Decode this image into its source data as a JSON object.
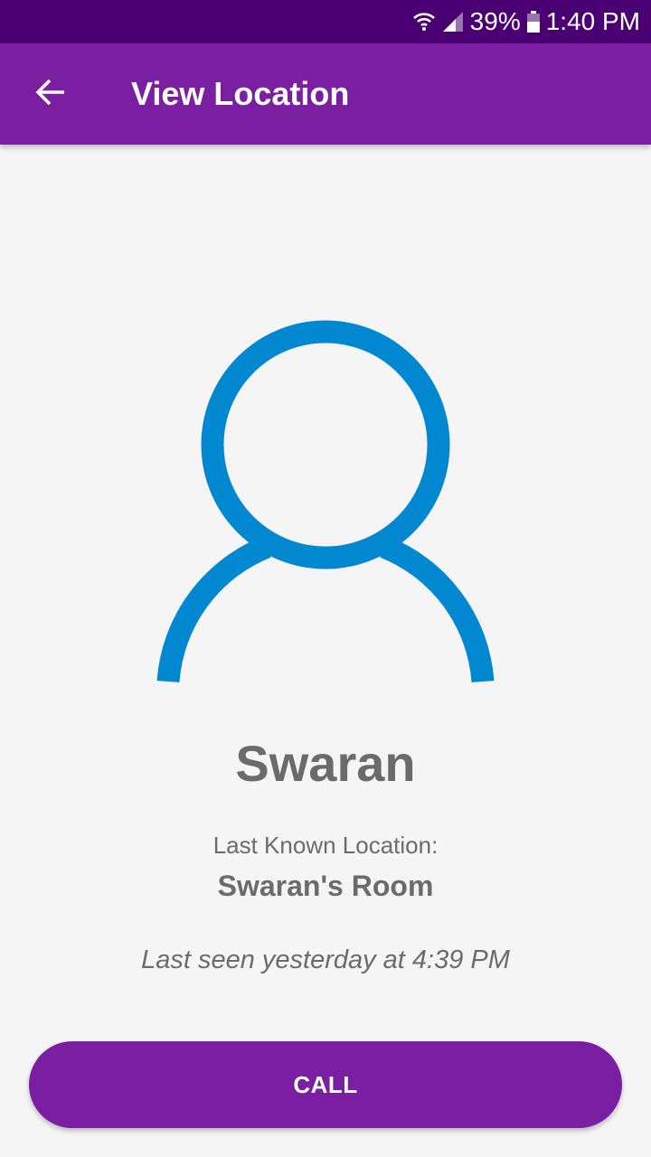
{
  "status_bar": {
    "battery_percent": "39%",
    "time": "1:40 PM",
    "icons": [
      "wifi-icon",
      "signal-icon",
      "battery-icon"
    ]
  },
  "app_bar": {
    "title": "View Location",
    "back_icon": "arrow-back-icon"
  },
  "profile": {
    "avatar_icon": "person-outline-icon",
    "name": "Swaran",
    "location_label": "Last Known Location:",
    "location_value": "Swaran's Room",
    "last_seen": "Last seen yesterday at 4:39 PM"
  },
  "actions": {
    "call_label": "CALL"
  },
  "colors": {
    "status_bar": "#4a0072",
    "primary": "#7b1fa2",
    "avatar_stroke": "#0288d1",
    "text_secondary": "#6b6b6b",
    "background": "#f5f5f5"
  }
}
